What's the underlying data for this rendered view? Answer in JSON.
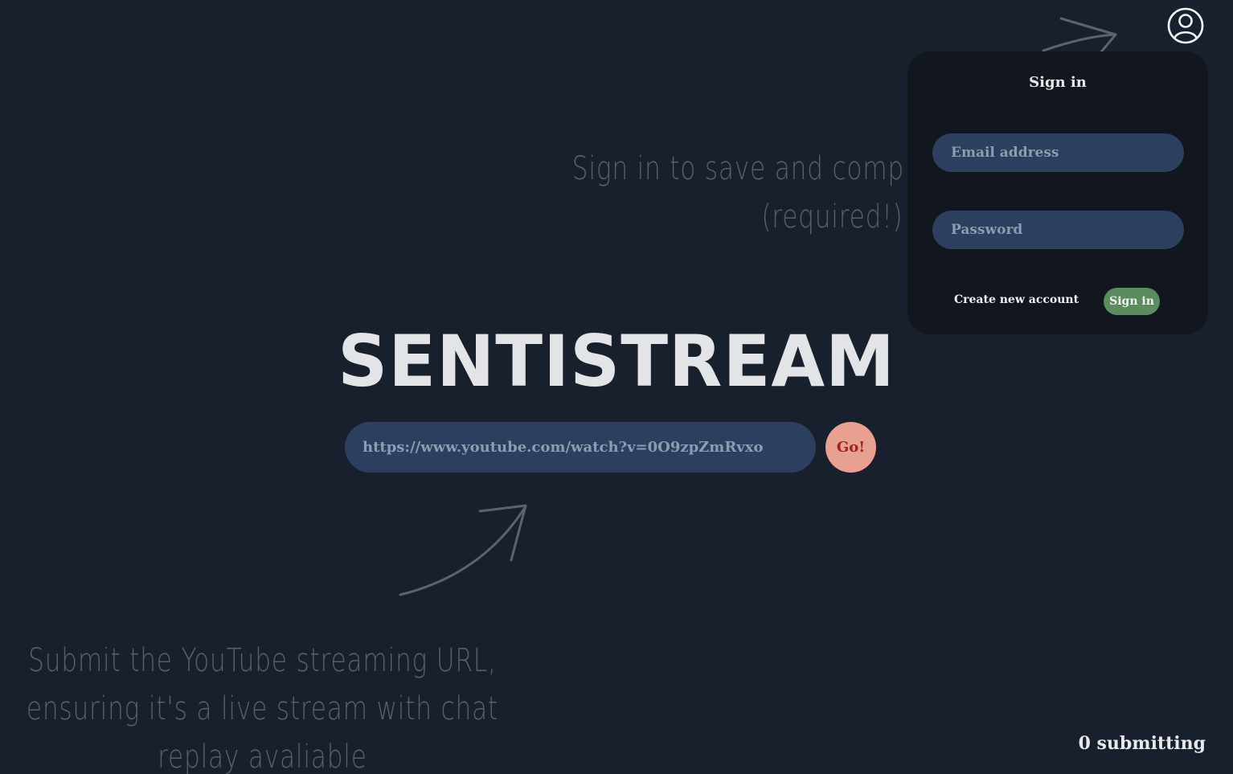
{
  "hints": {
    "signin_line1": "Sign in to save and comp",
    "signin_line2": "(required!)",
    "submit_line1": "Submit the YouTube streaming URL,",
    "submit_line2": "ensuring it's a live stream with chat",
    "submit_line3": "replay avaliable"
  },
  "main": {
    "title": "SENTISTREAM",
    "url_placeholder": "https://www.youtube.com/watch?v=0O9zpZmRvxo",
    "go_label": "Go!"
  },
  "header": {
    "user_icon": "user-circle-icon"
  },
  "signin_panel": {
    "title": "Sign in",
    "email_placeholder": "Email address",
    "password_placeholder": "Password",
    "create_account_label": "Create new account",
    "signin_button_label": "Sign in"
  },
  "status": {
    "submitting_text": "0 submitting"
  },
  "colors": {
    "background": "#18202e",
    "panel": "#12161e",
    "input": "#2d3f5e",
    "go_button": "#e8a090",
    "signin_button": "#5b8c5e"
  }
}
